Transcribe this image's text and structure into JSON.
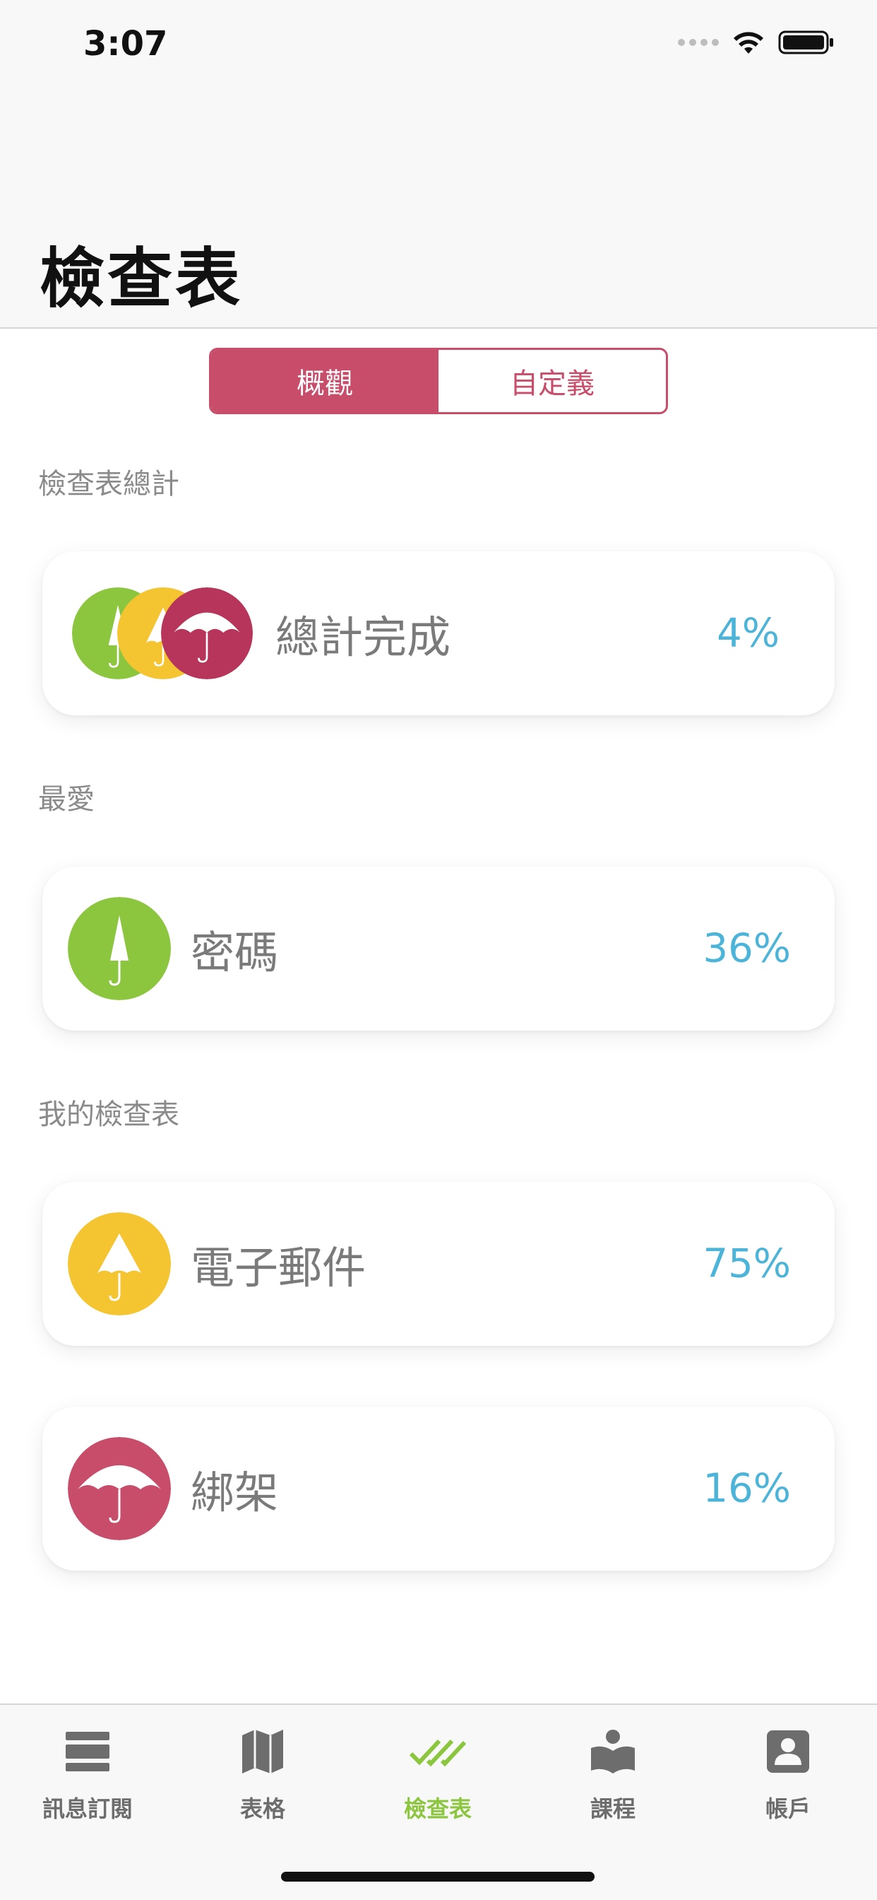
{
  "status_bar": {
    "time": "3:07"
  },
  "header": {
    "title": "檢查表"
  },
  "segmented": {
    "overview_label": "概觀",
    "custom_label": "自定義",
    "selected": "概觀"
  },
  "sections": {
    "total": {
      "label": "檢查表總計",
      "card": {
        "label": "總計完成",
        "percent": "4%",
        "progress": 0.04
      }
    },
    "favorites": {
      "label": "最愛",
      "card": {
        "label": "密碼",
        "percent": "36%",
        "progress": 0.36,
        "color": "#8cc63f"
      }
    },
    "my_checklists": {
      "label": "我的檢查表",
      "cards": [
        {
          "label": "電子郵件",
          "percent": "75%",
          "progress": 0.75,
          "color": "#f5c431"
        },
        {
          "label": "綁架",
          "percent": "16%",
          "progress": 0.16,
          "color": "#c84d6b"
        }
      ]
    }
  },
  "tabbar": {
    "tabs": [
      {
        "label": "訊息訂閱",
        "icon": "news-icon"
      },
      {
        "label": "表格",
        "icon": "map-icon"
      },
      {
        "label": "檢查表",
        "icon": "double-check-icon",
        "active": true
      },
      {
        "label": "課程",
        "icon": "course-reader-icon"
      },
      {
        "label": "帳戶",
        "icon": "account-icon"
      }
    ]
  },
  "colors": {
    "accent": "#c84d6b",
    "green": "#8cc63f",
    "yellow": "#f5c431",
    "crimson": "#c84d6b",
    "dark_crimson": "#b7345a",
    "percent": "#4bb4d8"
  }
}
